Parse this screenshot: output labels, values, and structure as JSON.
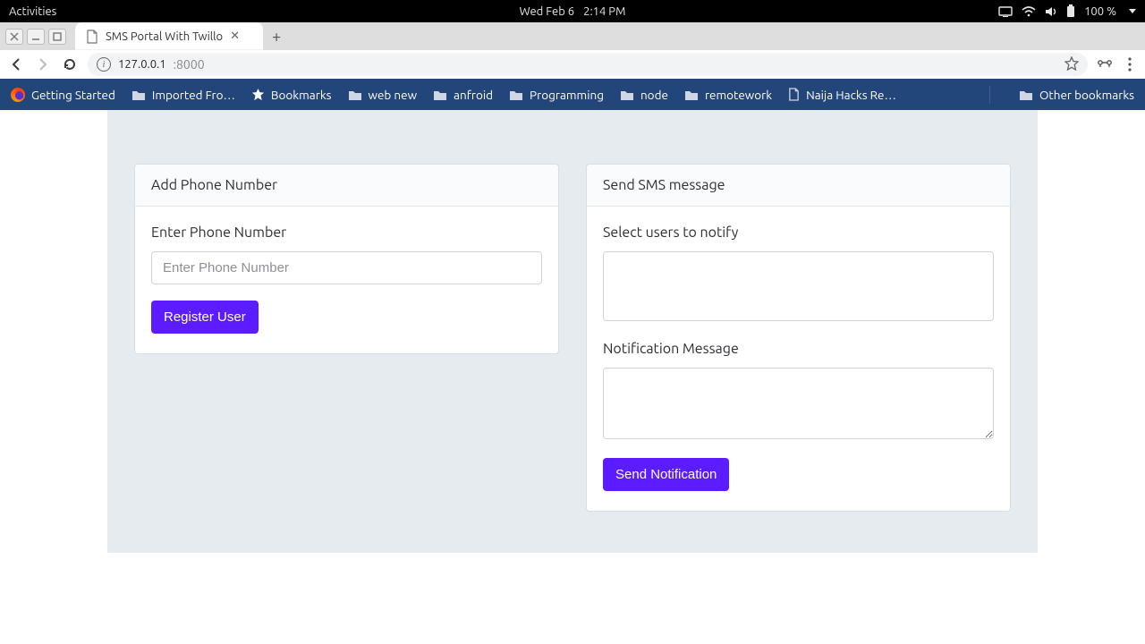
{
  "os": {
    "activities": "Activities",
    "date": "Wed Feb 6",
    "time": "2:14 PM",
    "battery": "100 %"
  },
  "browser": {
    "tab_title": "SMS Portal With Twillo",
    "url_host": "127.0.0.1",
    "url_port": ":8000",
    "bookmarks": [
      {
        "icon": "firefox",
        "label": "Getting Started"
      },
      {
        "icon": "folder",
        "label": "Imported Fro…"
      },
      {
        "icon": "star",
        "label": "Bookmarks"
      },
      {
        "icon": "folder",
        "label": "web new"
      },
      {
        "icon": "folder",
        "label": "anfroid"
      },
      {
        "icon": "folder",
        "label": "Programming"
      },
      {
        "icon": "folder",
        "label": "node"
      },
      {
        "icon": "folder",
        "label": "remotework"
      },
      {
        "icon": "doc",
        "label": "Naija Hacks Re…"
      }
    ],
    "other_bookmarks": "Other bookmarks"
  },
  "page": {
    "left": {
      "header": "Add Phone Number",
      "label": "Enter Phone Number",
      "placeholder": "Enter Phone Number",
      "button": "Register User"
    },
    "right": {
      "header": "Send SMS message",
      "select_label": "Select users to notify",
      "message_label": "Notification Message",
      "button": "Send Notification"
    }
  }
}
